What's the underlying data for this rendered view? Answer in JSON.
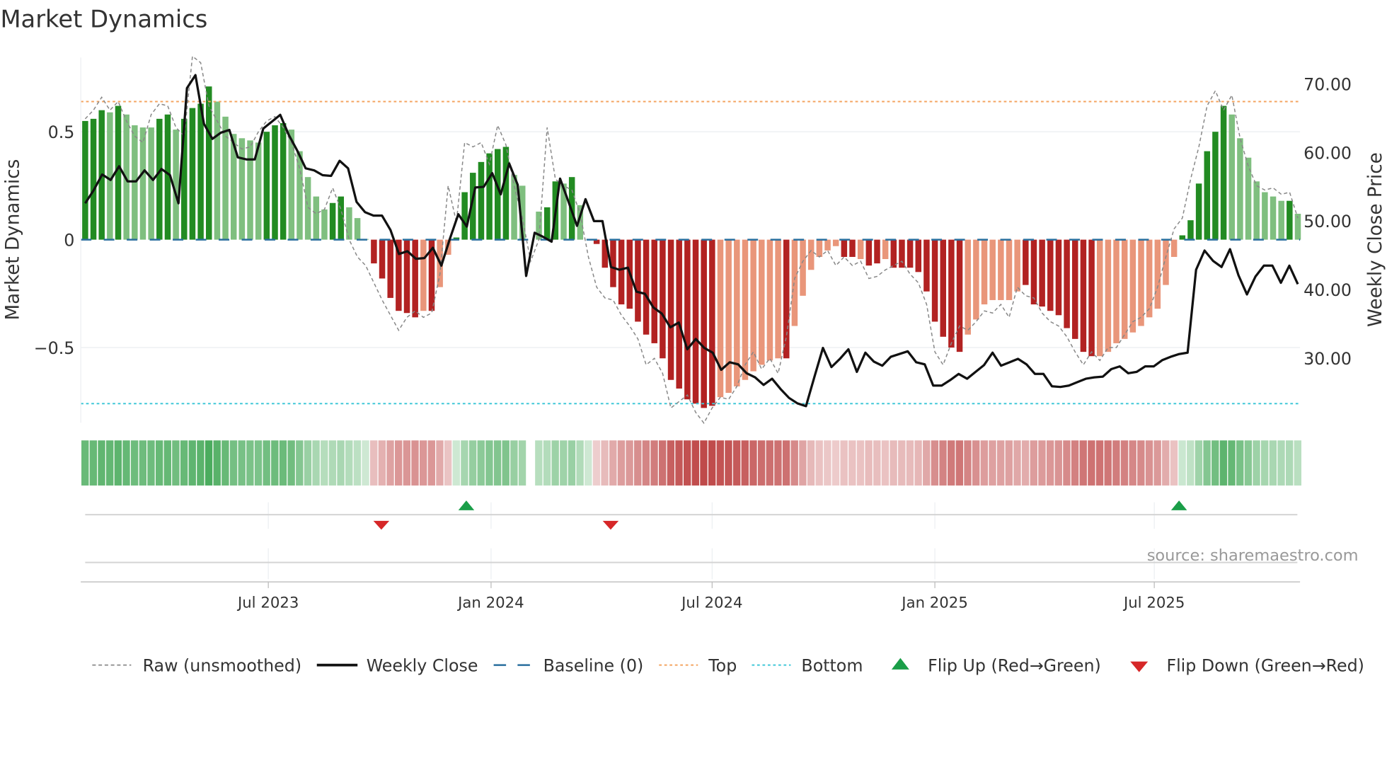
{
  "chart_data": {
    "type": "bar",
    "title": "Market Dynamics",
    "ylabel": "Market Dynamics",
    "y2label": "Weekly Close Price",
    "ylim": [
      -0.85,
      0.85
    ],
    "y2lim": [
      22,
      78
    ],
    "y_ticks": [
      {
        "value": 0.5,
        "label": "0.5"
      },
      {
        "value": 0,
        "label": "0"
      },
      {
        "value": -0.5,
        "label": "−0.5"
      }
    ],
    "y2_ticks": [
      {
        "value": 70,
        "label": "70.00"
      },
      {
        "value": 60,
        "label": "60.00"
      },
      {
        "value": 50,
        "label": "50.00"
      },
      {
        "value": 40,
        "label": "40.00"
      },
      {
        "value": 30,
        "label": "30.00"
      }
    ],
    "x_ticks": [
      {
        "week_index": 22.2,
        "label": "Jul 2023"
      },
      {
        "week_index": 49.2,
        "label": "Jan 2024"
      },
      {
        "week_index": 76.0,
        "label": "Jul 2024"
      },
      {
        "week_index": 103.0,
        "label": "Jan 2025"
      },
      {
        "week_index": 129.6,
        "label": "Jul 2025"
      }
    ],
    "top_level": 0.64,
    "bottom_level": -0.76,
    "baseline": 0,
    "smoothed": [
      0.55,
      0.56,
      0.6,
      0.59,
      0.62,
      0.58,
      0.53,
      0.52,
      0.52,
      0.56,
      0.58,
      0.51,
      0.56,
      0.61,
      0.63,
      0.71,
      0.64,
      0.57,
      0.49,
      0.47,
      0.46,
      0.45,
      0.5,
      0.53,
      0.54,
      0.51,
      0.41,
      0.29,
      0.2,
      0.14,
      0.17,
      0.2,
      0.15,
      0.1,
      0.003,
      -0.11,
      -0.18,
      -0.27,
      -0.33,
      -0.34,
      -0.36,
      -0.33,
      -0.33,
      -0.22,
      -0.07,
      0.01,
      0.22,
      0.31,
      0.36,
      0.4,
      0.42,
      0.43,
      0.3,
      0.25,
      null,
      0.13,
      0.15,
      0.27,
      0.26,
      0.29,
      0.16,
      0,
      -0.02,
      -0.13,
      -0.22,
      -0.3,
      -0.32,
      -0.38,
      -0.44,
      -0.48,
      -0.55,
      -0.65,
      -0.69,
      -0.74,
      -0.76,
      -0.78,
      -0.77,
      -0.73,
      -0.71,
      -0.68,
      -0.65,
      -0.61,
      -0.58,
      -0.56,
      -0.55,
      -0.55,
      -0.4,
      -0.26,
      -0.14,
      -0.08,
      -0.05,
      -0.03,
      -0.08,
      -0.08,
      -0.09,
      -0.12,
      -0.11,
      -0.09,
      -0.13,
      -0.13,
      -0.13,
      -0.15,
      -0.24,
      -0.38,
      -0.45,
      -0.5,
      -0.52,
      -0.44,
      -0.37,
      -0.3,
      -0.28,
      -0.28,
      -0.28,
      -0.24,
      -0.21,
      -0.3,
      -0.31,
      -0.33,
      -0.35,
      -0.41,
      -0.46,
      -0.52,
      -0.54,
      -0.54,
      -0.52,
      -0.48,
      -0.46,
      -0.43,
      -0.4,
      -0.36,
      -0.32,
      -0.21,
      -0.08,
      0.02,
      0.09,
      0.26,
      0.41,
      0.5,
      0.62,
      0.58,
      0.47,
      0.38,
      0.27,
      0.22,
      0.2,
      0.18,
      0.18,
      0.12
    ],
    "strong": [
      1,
      1,
      1,
      0,
      1,
      0,
      0,
      0,
      0,
      1,
      1,
      0,
      1,
      1,
      1,
      1,
      0,
      0,
      0,
      0,
      0,
      0,
      1,
      1,
      1,
      0,
      0,
      0,
      0,
      0,
      1,
      1,
      0,
      0,
      0,
      1,
      1,
      1,
      1,
      1,
      1,
      0,
      1,
      0,
      0,
      1,
      1,
      1,
      1,
      1,
      1,
      1,
      0,
      0,
      0,
      0,
      1,
      1,
      0,
      1,
      0,
      0,
      1,
      1,
      1,
      1,
      1,
      1,
      1,
      1,
      1,
      1,
      1,
      1,
      1,
      1,
      1,
      0,
      0,
      0,
      0,
      0,
      0,
      0,
      0,
      1,
      0,
      0,
      0,
      0,
      0,
      0,
      1,
      1,
      0,
      1,
      1,
      0,
      1,
      1,
      1,
      1,
      1,
      1,
      1,
      1,
      1,
      0,
      0,
      0,
      0,
      0,
      0,
      0,
      1,
      1,
      1,
      1,
      1,
      1,
      1,
      1,
      1,
      0,
      0,
      0,
      0,
      0,
      0,
      0,
      0,
      0,
      0,
      1,
      1,
      1,
      1,
      1,
      1,
      0,
      0,
      0,
      0,
      0,
      0,
      0,
      1,
      0
    ],
    "raw": [
      0.56,
      0.6,
      0.66,
      0.6,
      0.64,
      0.55,
      0.48,
      0.45,
      0.58,
      0.63,
      0.62,
      0.52,
      0.48,
      0.85,
      0.82,
      0.62,
      0.55,
      0.48,
      0.45,
      0.42,
      0.43,
      0.5,
      0.55,
      0.57,
      0.52,
      0.45,
      0.33,
      0.15,
      0.12,
      0.14,
      0.24,
      0.14,
      0.0,
      -0.08,
      -0.12,
      -0.2,
      -0.28,
      -0.35,
      -0.42,
      -0.36,
      -0.33,
      -0.36,
      -0.34,
      -0.16,
      0.25,
      0.08,
      0.45,
      0.43,
      0.45,
      0.35,
      0.53,
      0.44,
      0.25,
      0.1,
      -0.1,
      0.0,
      0.52,
      0.28,
      0.25,
      0.23,
      0.12,
      -0.08,
      -0.22,
      -0.27,
      -0.28,
      -0.35,
      -0.4,
      -0.46,
      -0.58,
      -0.55,
      -0.62,
      -0.78,
      -0.75,
      -0.72,
      -0.8,
      -0.85,
      -0.78,
      -0.73,
      -0.74,
      -0.68,
      -0.58,
      -0.52,
      -0.6,
      -0.55,
      -0.62,
      -0.45,
      -0.18,
      -0.1,
      -0.05,
      -0.08,
      -0.05,
      -0.12,
      -0.08,
      -0.12,
      -0.1,
      -0.18,
      -0.17,
      -0.14,
      -0.12,
      -0.1,
      -0.16,
      -0.2,
      -0.3,
      -0.52,
      -0.58,
      -0.48,
      -0.4,
      -0.42,
      -0.38,
      -0.33,
      -0.34,
      -0.3,
      -0.36,
      -0.22,
      -0.26,
      -0.27,
      -0.34,
      -0.38,
      -0.4,
      -0.45,
      -0.52,
      -0.58,
      -0.52,
      -0.56,
      -0.5,
      -0.5,
      -0.44,
      -0.38,
      -0.36,
      -0.32,
      -0.22,
      -0.08,
      0.05,
      0.1,
      0.28,
      0.43,
      0.62,
      0.69,
      0.6,
      0.67,
      0.47,
      0.34,
      0.25,
      0.23,
      0.24,
      0.21,
      0.22,
      0.1
    ],
    "close": [
      52.6,
      54.5,
      56.8,
      56,
      58,
      55.8,
      55.8,
      57.4,
      56,
      57.6,
      56.7,
      52.6,
      69.4,
      71.3,
      64.2,
      62,
      62.9,
      63.3,
      59.3,
      59,
      59,
      63.5,
      64.5,
      65.5,
      62.6,
      60.3,
      57.7,
      57.4,
      56.7,
      56.6,
      58.8,
      57.7,
      52.8,
      51.3,
      50.8,
      50.8,
      48.7,
      45.2,
      45.6,
      44.5,
      44.6,
      46.1,
      43.5,
      47.4,
      51,
      49.2,
      54.9,
      55,
      57,
      53.9,
      58.4,
      55.3,
      42,
      48.3,
      47.7,
      47,
      56.2,
      52.8,
      49.3,
      53.2,
      50,
      50,
      43.3,
      42.9,
      43.2,
      39.7,
      39.4,
      37.4,
      36.5,
      34.5,
      35.2,
      31.3,
      32.8,
      31.5,
      30.8,
      28.3,
      29.4,
      29.1,
      27.8,
      27.2,
      26.1,
      27,
      25.5,
      24.2,
      23.4,
      23,
      27.3,
      31.5,
      28.7,
      29.9,
      31.3,
      28,
      30.8,
      29.5,
      28.9,
      30.2,
      30.6,
      31,
      29.4,
      29.1,
      26,
      26,
      26.8,
      27.7,
      27,
      28,
      29,
      30.8,
      28.9,
      29.4,
      29.9,
      29.1,
      27.7,
      27.7,
      25.9,
      25.8,
      26,
      26.5,
      27,
      27.2,
      27.3,
      28.4,
      28.8,
      27.8,
      28,
      28.8,
      28.8,
      29.7,
      30.2,
      30.6,
      30.8,
      42.9,
      45.7,
      44.2,
      43.3,
      45.9,
      42.1,
      39.3,
      41.9,
      43.5,
      43.5,
      41,
      43.5,
      40.8
    ],
    "flips": [
      {
        "week_index": 35.9,
        "type": "down"
      },
      {
        "week_index": 46.2,
        "type": "up"
      },
      {
        "week_index": 63.7,
        "type": "down"
      },
      {
        "week_index": 132.6,
        "type": "up"
      }
    ],
    "legend": {
      "placement": "bottom",
      "items": [
        {
          "key": "raw",
          "label": "Raw (unsmoothed)"
        },
        {
          "key": "close",
          "label": "Weekly Close"
        },
        {
          "key": "baseline",
          "label": "Baseline (0)"
        },
        {
          "key": "top",
          "label": "Top"
        },
        {
          "key": "bottom",
          "label": "Bottom"
        },
        {
          "key": "flip_up",
          "label": "Flip Up (Red→Green)"
        },
        {
          "key": "flip_down",
          "label": "Flip Down (Green→Red)"
        }
      ]
    },
    "colors": {
      "green_strong": "#228b22",
      "green_weak": "#7fbf7f",
      "red_strong": "#b22222",
      "red_weak": "#e9967a",
      "top": "#f4a460",
      "bottom": "#40c8d8",
      "baseline": "#2a6f9e",
      "close": "#111111",
      "raw": "#888888",
      "flip_up": "#1a9e48",
      "flip_down": "#d62728"
    },
    "source": "source: sharemaestro.com"
  }
}
